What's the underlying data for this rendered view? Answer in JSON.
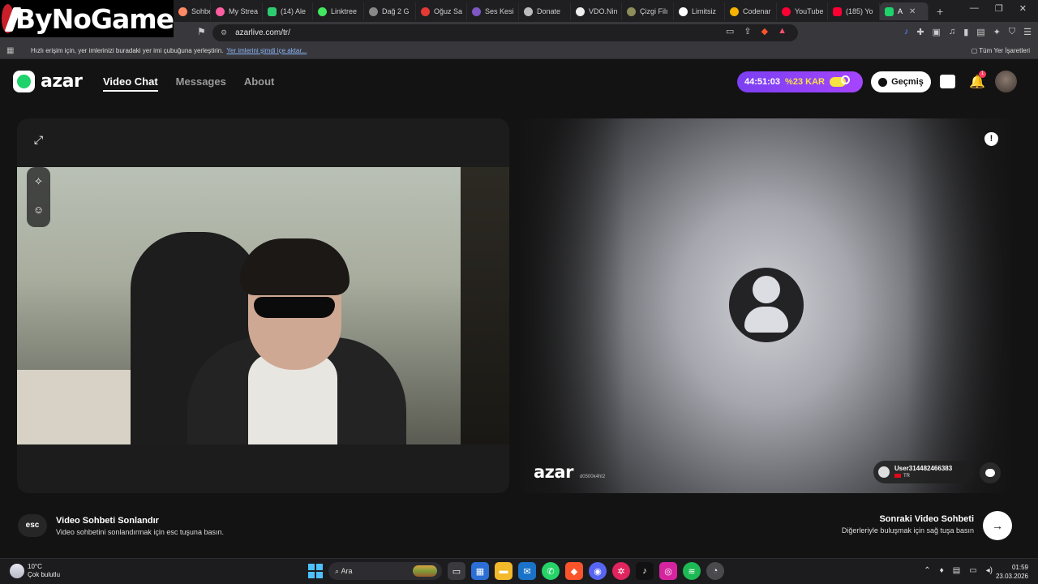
{
  "overlay": {
    "logo_text": "ByNoGame"
  },
  "browser": {
    "tabs": [
      {
        "label": "Sohbet",
        "color": "#ff8a65"
      },
      {
        "label": "My Strea",
        "color": "#ff5ea0"
      },
      {
        "label": "(14) Ale",
        "color": "#2ecc71"
      },
      {
        "label": "Linktree",
        "color": "#43e660"
      },
      {
        "label": "Dağ 2 G",
        "color": "#888888"
      },
      {
        "label": "Oğuz Sa",
        "color": "#e53935"
      },
      {
        "label": "Ses Kesi",
        "color": "#7e57c2"
      },
      {
        "label": "Donate",
        "color": "#bbbbbb"
      },
      {
        "label": "VDO.Nin",
        "color": "#eeeeee"
      },
      {
        "label": "Çizgi Filı",
        "color": "#8d8d5c"
      },
      {
        "label": "Limitsiz",
        "color": "#ffffff"
      },
      {
        "label": "Codenar",
        "color": "#f4b400"
      },
      {
        "label": "YouTube",
        "color": "#ff0033"
      },
      {
        "label": "(185) Yo",
        "color": "#ff0033"
      },
      {
        "label": "A",
        "color": "#1ed36b"
      }
    ],
    "new_tab": "+",
    "close": "✕",
    "url": "azarlive.com/tr/",
    "bookmarks_hint": "Hızlı erişim için, yer imlerinizi buradaki yer imi çubuğuna yerleştirin.",
    "bookmarks_import": "Yer imlerini şimdi içe aktar...",
    "all_bookmarks": "Tüm Yer İşaretleri"
  },
  "app": {
    "brand": "azar",
    "nav": {
      "video_chat": "Video Chat",
      "messages": "Messages",
      "about": "About"
    },
    "promo": {
      "timer": "44:51:03",
      "discount": "%23 KAR"
    },
    "history_label": "Geçmiş",
    "notification_count": "1",
    "report_symbol": "!",
    "watermark": "azar",
    "watermark_id": "d0500k4ht2",
    "peer": {
      "username": "User314482466383",
      "country": "TR"
    },
    "end_chat": {
      "key": "esc",
      "title": "Video Sohbeti Sonlandır",
      "subtitle": "Video sohbetini sonlandırmak için esc tuşuna basın."
    },
    "next_chat": {
      "title": "Sonraki Video Sohbeti",
      "subtitle": "Diğerleriyle buluşmak için sağ tuşa basın",
      "arrow": "→"
    }
  },
  "taskbar": {
    "temperature": "10°C",
    "weather": "Çok bulutlu",
    "search_placeholder": "Ara",
    "time": "01:59",
    "date": "23.03.2026"
  }
}
